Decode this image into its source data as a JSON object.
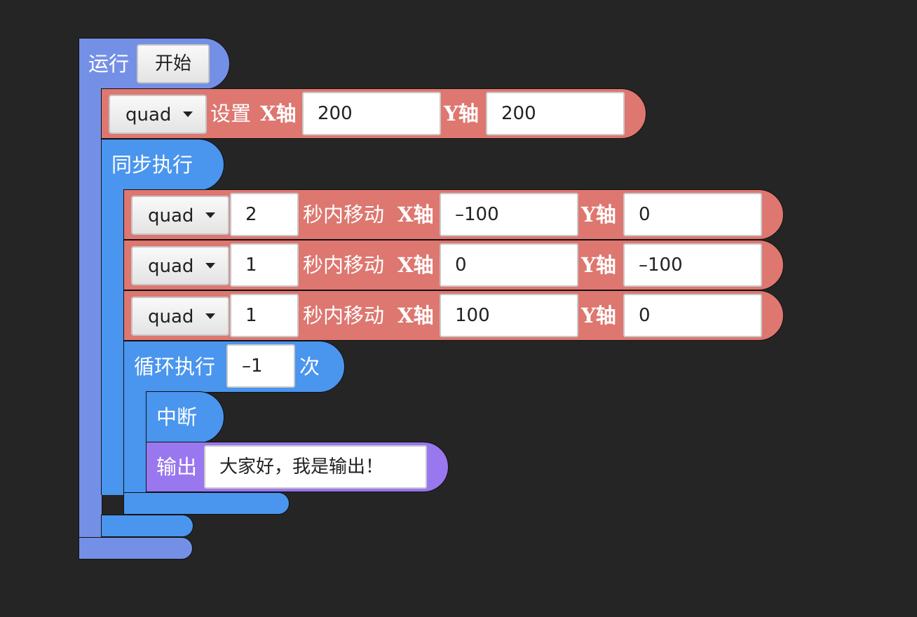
{
  "run_block": {
    "label": "运行",
    "start_button": "开始"
  },
  "set_block": {
    "sprite": "quad",
    "label_set": "设置",
    "label_x": "X轴",
    "x_value": "200",
    "label_y": "Y轴",
    "y_value": "200"
  },
  "parallel_block": {
    "label": "同步执行"
  },
  "move_blocks": [
    {
      "sprite": "quad",
      "seconds": "2",
      "label_move": "秒内移动",
      "label_x": "X轴",
      "x_value": "–100",
      "label_y": "Y轴",
      "y_value": "0"
    },
    {
      "sprite": "quad",
      "seconds": "1",
      "label_move": "秒内移动",
      "label_x": "X轴",
      "x_value": "0",
      "label_y": "Y轴",
      "y_value": "–100"
    },
    {
      "sprite": "quad",
      "seconds": "1",
      "label_move": "秒内移动",
      "label_x": "X轴",
      "x_value": "100",
      "label_y": "Y轴",
      "y_value": "0"
    }
  ],
  "loop_block": {
    "label": "循环执行",
    "count": "–1",
    "suffix": "次"
  },
  "break_block": {
    "label": "中断"
  },
  "output_block": {
    "label": "输出",
    "text": "大家好，我是输出！"
  },
  "colors": {
    "background": "#252525",
    "run": "#7490e6",
    "motion": "#dd7770",
    "control": "#4a95ee",
    "output": "#9977ee"
  }
}
